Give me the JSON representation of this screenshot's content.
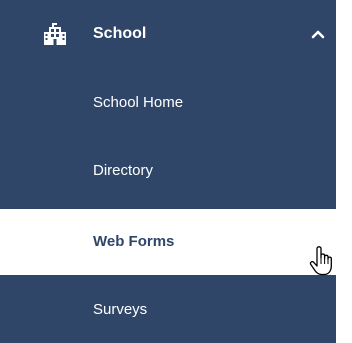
{
  "section": {
    "title": "School",
    "icon": "building-icon",
    "expanded": true,
    "chevron_icon": "chevron-up-icon"
  },
  "menu": {
    "items": [
      {
        "label": "School Home",
        "active": false
      },
      {
        "label": "Directory",
        "active": false
      },
      {
        "label": "Web Forms",
        "active": true
      },
      {
        "label": "Surveys",
        "active": false
      }
    ]
  },
  "colors": {
    "sidebar_background": "#2f4668",
    "active_background": "#ffffff",
    "text": "#ffffff",
    "active_text": "#2f4668"
  },
  "cursor": {
    "icon": "hand-pointer-icon"
  }
}
